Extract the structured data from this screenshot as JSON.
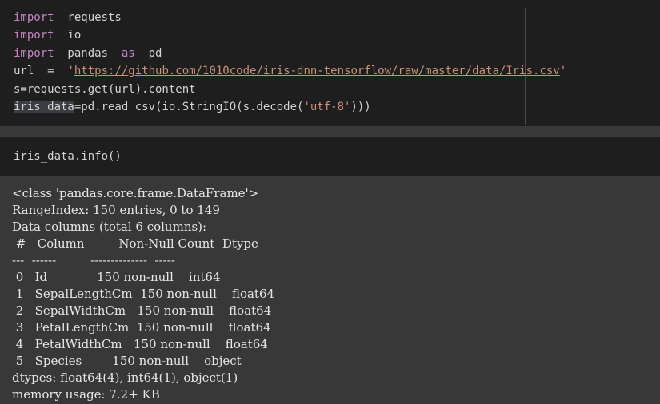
{
  "cell1": {
    "lines": [
      {
        "kw": "import",
        "rest": "  requests"
      },
      {
        "kw": "import",
        "rest": "  io"
      },
      {
        "kw": "import",
        "rest": "  pandas  ",
        "kw2": "as",
        "rest2": "  pd"
      },
      {
        "pre": "url  =  ",
        "q1": "'",
        "url": "https://github.com/1010code/iris-dnn-tensorflow/raw/master/data/Iris.csv",
        "q2": "'"
      },
      {
        "pre": "s=requests.get(url).content"
      },
      {
        "hl": "iris_data",
        "pre": "=pd.read_csv(io.StringIO(s.decode(",
        "str": "'utf-8'",
        "post": ")))"
      }
    ]
  },
  "cell2": {
    "code": "iris_data.info()"
  },
  "output": {
    "lines": [
      "<class 'pandas.core.frame.DataFrame'>",
      "RangeIndex: 150 entries, 0 to 149",
      "Data columns (total 6 columns):",
      " #   Column         Non-Null Count  Dtype  ",
      "---  ------         --------------  -----  ",
      " 0   Id             150 non-null    int64  ",
      " 1   SepalLengthCm  150 non-null    float64",
      " 2   SepalWidthCm   150 non-null    float64",
      " 3   PetalLengthCm  150 non-null    float64",
      " 4   PetalWidthCm   150 non-null    float64",
      " 5   Species        150 non-null    object ",
      "dtypes: float64(4), int64(1), object(1)",
      "memory usage: 7.2+ KB"
    ]
  }
}
